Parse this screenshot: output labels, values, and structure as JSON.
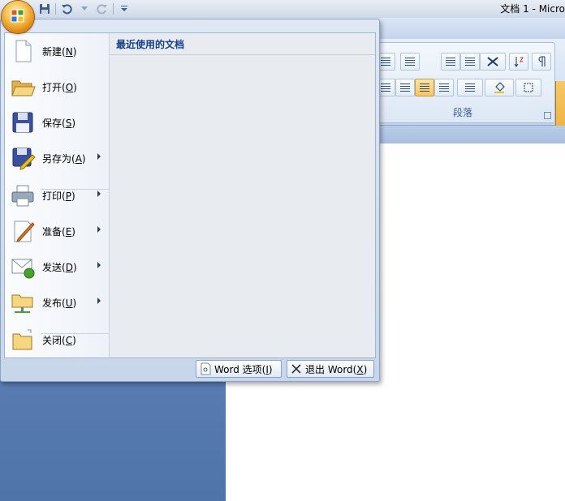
{
  "window": {
    "title": "文档 1 - Micro"
  },
  "ribbon": {
    "paragraph_group_label": "段落"
  },
  "office_menu": {
    "items": [
      {
        "label": "新建",
        "key": "N",
        "submenu": false
      },
      {
        "label": "打开",
        "key": "O",
        "submenu": false
      },
      {
        "label": "保存",
        "key": "S",
        "submenu": false
      },
      {
        "label": "另存为",
        "key": "A",
        "submenu": true
      },
      {
        "label": "打印",
        "key": "P",
        "submenu": true
      },
      {
        "label": "准备",
        "key": "E",
        "submenu": true
      },
      {
        "label": "发送",
        "key": "D",
        "submenu": true
      },
      {
        "label": "发布",
        "key": "U",
        "submenu": true
      },
      {
        "label": "关闭",
        "key": "C",
        "submenu": false
      }
    ],
    "recent_title": "最近使用的文档",
    "options_button": {
      "label": "Word 选项",
      "key": "I"
    },
    "exit_button": {
      "label": "退出 Word",
      "key": "X"
    }
  },
  "colors": {
    "accent": "#15428b",
    "orb": "#f9c75c",
    "menu_bg": "#e8ebf0"
  }
}
